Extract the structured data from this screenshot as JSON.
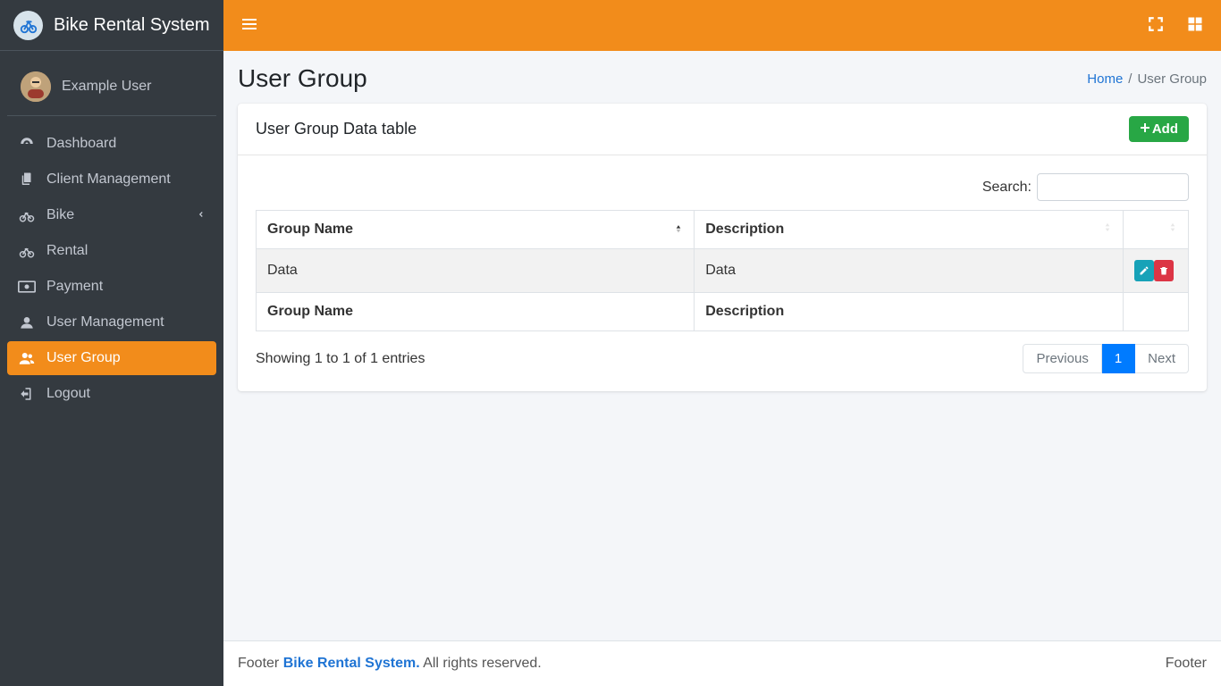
{
  "brand": {
    "name": "Bike Rental System"
  },
  "user": {
    "name": "Example User"
  },
  "sidebar": {
    "items": [
      {
        "label": "Dashboard"
      },
      {
        "label": "Client Management"
      },
      {
        "label": "Bike"
      },
      {
        "label": "Rental"
      },
      {
        "label": "Payment"
      },
      {
        "label": "User Management"
      },
      {
        "label": "User Group"
      },
      {
        "label": "Logout"
      }
    ]
  },
  "page": {
    "title": "User Group",
    "breadcrumb_home": "Home",
    "breadcrumb_sep": "/",
    "breadcrumb_current": "User Group"
  },
  "card": {
    "title": "User Group Data table",
    "add_label": "Add",
    "search_label": "Search:",
    "columns": {
      "group_name": "Group Name",
      "description": "Description"
    },
    "rows": [
      {
        "group_name": "Data",
        "description": "Data"
      }
    ],
    "info": "Showing 1 to 1 of 1 entries",
    "pagination": {
      "prev": "Previous",
      "next": "Next",
      "current": "1"
    }
  },
  "footer": {
    "left_prefix": "Footer ",
    "brand_link": "Bike Rental System.",
    "left_suffix": " All rights reserved.",
    "right": "Footer"
  }
}
